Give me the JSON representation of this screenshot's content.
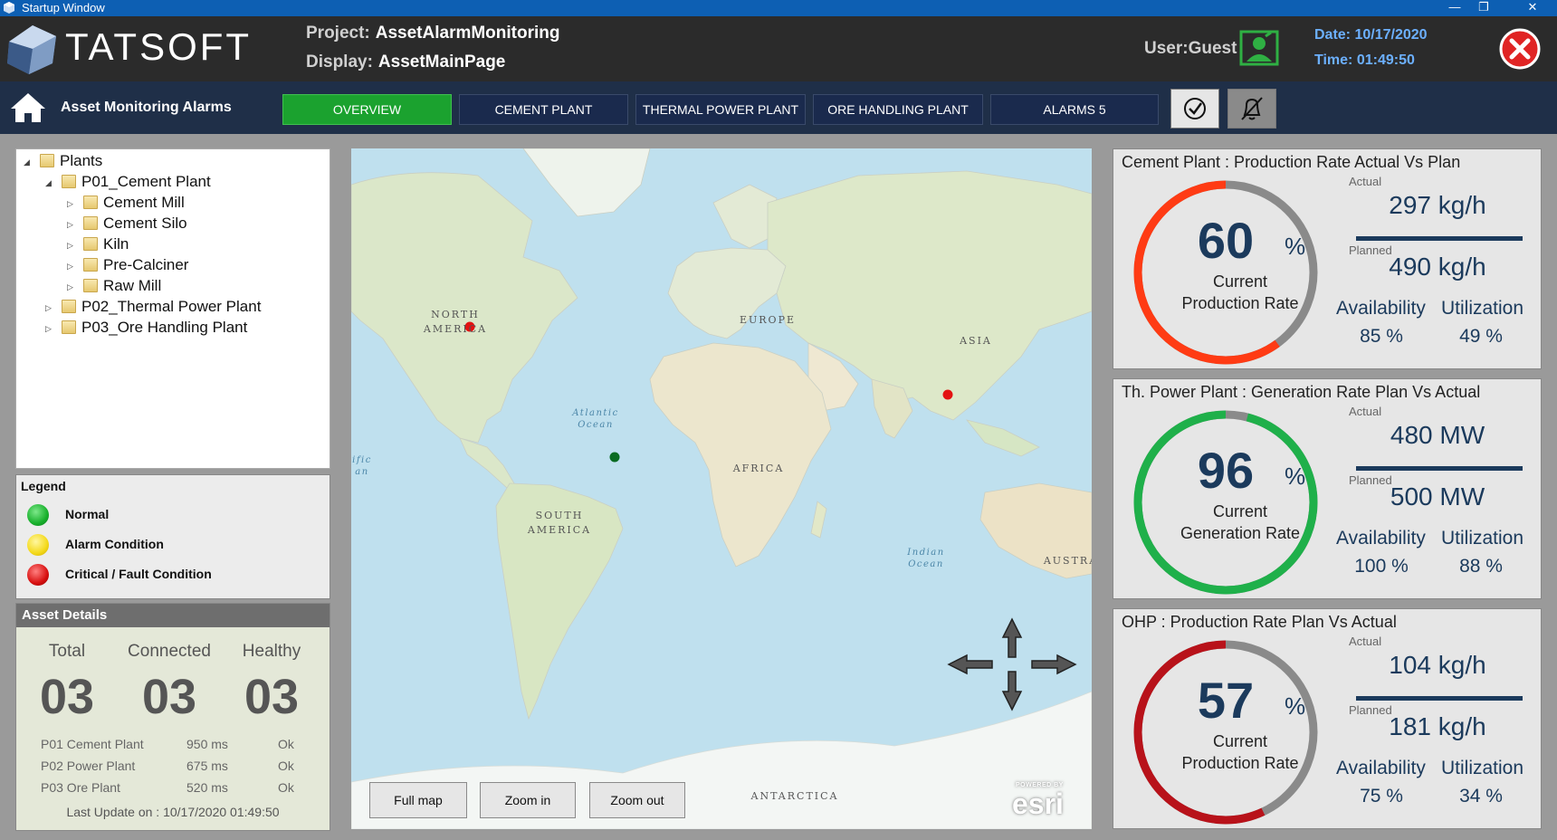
{
  "window": {
    "title": "Startup Window",
    "minimize": "—",
    "restore": "❐",
    "close": "✕"
  },
  "header": {
    "logo_text": "TATSOFT",
    "project_label": "Project:",
    "project_value": "AssetAlarmMonitoring",
    "display_label": "Display:",
    "display_value": "AssetMainPage",
    "user": "User:Guest",
    "date": "Date: 10/17/2020",
    "time": "Time: 01:49:50"
  },
  "nav": {
    "title": "Asset Monitoring Alarms",
    "tabs": [
      {
        "label": "OVERVIEW",
        "active": true
      },
      {
        "label": "CEMENT PLANT"
      },
      {
        "label": "THERMAL POWER PLANT"
      },
      {
        "label": "ORE HANDLING PLANT"
      },
      {
        "label": "ALARMS 5"
      }
    ]
  },
  "tree": {
    "root": "Plants",
    "p01": "P01_Cement Plant",
    "p01_children": [
      "Cement Mill",
      "Cement Silo",
      "Kiln",
      "Pre-Calciner",
      "Raw Mill"
    ],
    "p02": "P02_Thermal Power Plant",
    "p03": "P03_Ore Handling Plant"
  },
  "legend": {
    "title": "Legend",
    "items": [
      {
        "label": "Normal",
        "color": "#18b02c"
      },
      {
        "label": "Alarm Condition",
        "color": "#f4d91a"
      },
      {
        "label": "Critical / Fault Condition",
        "color": "#d81010"
      }
    ]
  },
  "asset_details": {
    "title": "Asset Details",
    "headers": [
      "Total",
      "Connected",
      "Healthy"
    ],
    "values": [
      "03",
      "03",
      "03"
    ],
    "rows": [
      {
        "name": "P01 Cement Plant",
        "latency": "950 ms",
        "status": "Ok"
      },
      {
        "name": "P02 Power Plant",
        "latency": "675 ms",
        "status": "Ok"
      },
      {
        "name": "P03 Ore Plant",
        "latency": "520 ms",
        "status": "Ok"
      }
    ],
    "last_update": "Last Update on : 10/17/2020 01:49:50"
  },
  "map": {
    "labels": {
      "north_america": "NORTH AMERICA",
      "europe": "EUROPE",
      "asia": "ASIA",
      "africa": "AFRICA",
      "south_america": "SOUTH AMERICA",
      "austral": "AUSTRA",
      "antarctica": "ANTARCTICA",
      "atlantic": "Atlantic Ocean",
      "indian": "Indian Ocean",
      "pacific": "ific an"
    },
    "buttons": {
      "full": "Full map",
      "zoom_in": "Zoom in",
      "zoom_out": "Zoom out"
    },
    "attribution_small": "POWERED BY",
    "attribution": "esri",
    "marker_colors": {
      "critical": "#e31212",
      "normal": "#0a6b22"
    }
  },
  "kpis": [
    {
      "title": "Cement Plant : Production Rate Actual Vs Plan",
      "value": "60",
      "percent_sign": "%",
      "value_fraction": 0.6,
      "line1": "Current",
      "line2": "Production Rate",
      "actual_label": "Actual",
      "actual": "297 kg/h",
      "planned_label": "Planned",
      "planned": "490 kg/h",
      "availability_label": "Availability",
      "availability": "85 %",
      "utilization_label": "Utilization",
      "utilization": "49 %",
      "color": "#ff3b14"
    },
    {
      "title": "Th. Power Plant : Generation Rate Plan Vs Actual",
      "value": "96",
      "percent_sign": "%",
      "value_fraction": 0.96,
      "line1": "Current",
      "line2": "Generation Rate",
      "actual_label": "Actual",
      "actual": "480 MW",
      "planned_label": "Planned",
      "planned": "500 MW",
      "availability_label": "Availability",
      "availability": "100 %",
      "utilization_label": "Utilization",
      "utilization": "88 %",
      "color": "#1fb04a"
    },
    {
      "title": "OHP : Production Rate Plan Vs Actual",
      "value": "57",
      "percent_sign": "%",
      "value_fraction": 0.57,
      "line1": "Current",
      "line2": "Production Rate",
      "actual_label": "Actual",
      "actual": "104 kg/h",
      "planned_label": "Planned",
      "planned": "181 kg/h",
      "availability_label": "Availability",
      "availability": "75 %",
      "utilization_label": "Utilization",
      "utilization": "34 %",
      "color": "#b8121a"
    }
  ]
}
